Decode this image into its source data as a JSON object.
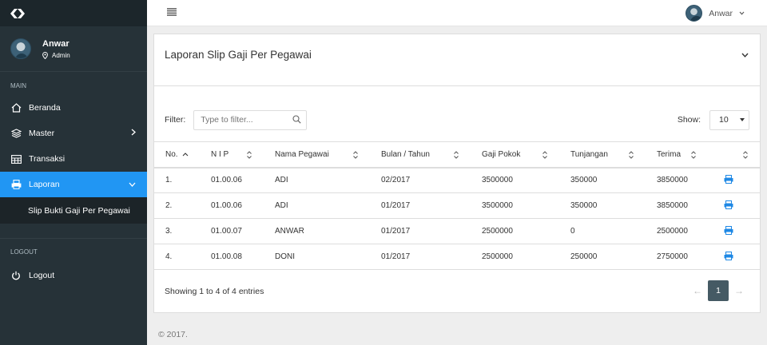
{
  "sidebar": {
    "user": {
      "name": "Anwar",
      "role": "Admin"
    },
    "sections": [
      {
        "label": "MAIN"
      },
      {
        "label": "LOGOUT"
      }
    ],
    "items": [
      {
        "label": "Beranda",
        "icon": "home-icon"
      },
      {
        "label": "Master",
        "icon": "layers-icon"
      },
      {
        "label": "Transaksi",
        "icon": "table-icon"
      },
      {
        "label": "Laporan",
        "icon": "printer-icon"
      },
      {
        "label": "Logout",
        "icon": "power-icon"
      }
    ],
    "subitem": "Slip Bukti Gaji Per Pegawai"
  },
  "topbar": {
    "user_name": "Anwar"
  },
  "panel": {
    "title": "Laporan Slip Gaji Per Pegawai",
    "filter_label": "Filter:",
    "filter_placeholder": "Type to filter...",
    "show_label": "Show:",
    "show_value": "10"
  },
  "table": {
    "headers": [
      "No.",
      "N I P",
      "Nama Pegawai",
      "Bulan / Tahun",
      "Gaji Pokok",
      "Tunjangan",
      "Terima"
    ],
    "rows": [
      [
        "1.",
        "01.00.06",
        "ADI",
        "02/2017",
        "3500000",
        "350000",
        "3850000"
      ],
      [
        "2.",
        "01.00.06",
        "ADI",
        "01/2017",
        "3500000",
        "350000",
        "3850000"
      ],
      [
        "3.",
        "01.00.07",
        "ANWAR",
        "01/2017",
        "2500000",
        "0",
        "2500000"
      ],
      [
        "4.",
        "01.00.08",
        "DONI",
        "01/2017",
        "2500000",
        "250000",
        "2750000"
      ]
    ]
  },
  "footer": {
    "info": "Showing 1 to 4 of 4 entries",
    "prev": "←",
    "page": "1",
    "next": "→",
    "copyright": "© 2017."
  },
  "colors": {
    "accent": "#2196f3",
    "sidebar": "#263238",
    "pager_active": "#455a64"
  }
}
